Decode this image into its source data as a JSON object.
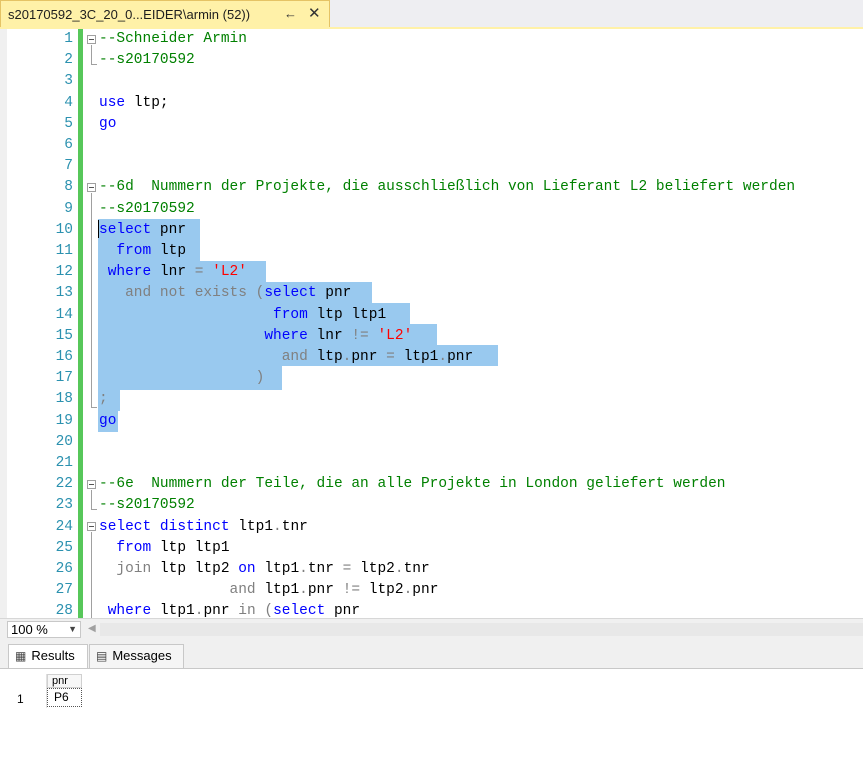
{
  "tab": {
    "title": "s20170592_3C_20_0...EIDER\\armin (52))",
    "pin_icon": "pin-icon",
    "close_icon": "close-icon"
  },
  "editor": {
    "lines": [
      {
        "n": "1",
        "segs": [
          {
            "t": "--Schneider Armin",
            "c": "cm"
          }
        ]
      },
      {
        "n": "2",
        "segs": [
          {
            "t": "--s20170592",
            "c": "cm"
          }
        ]
      },
      {
        "n": "3",
        "segs": []
      },
      {
        "n": "4",
        "segs": [
          {
            "t": "use",
            "c": "kw"
          },
          {
            "t": " ltp;",
            "c": ""
          }
        ]
      },
      {
        "n": "5",
        "segs": [
          {
            "t": "go",
            "c": "kw"
          }
        ]
      },
      {
        "n": "6",
        "segs": []
      },
      {
        "n": "7",
        "segs": []
      },
      {
        "n": "8",
        "segs": [
          {
            "t": "--6d  Nummern der Projekte, die ausschließlich von Lieferant L2 beliefert werden",
            "c": "cm"
          }
        ]
      },
      {
        "n": "9",
        "segs": [
          {
            "t": "--s20170592",
            "c": "cm"
          }
        ]
      },
      {
        "n": "10",
        "segs": [
          {
            "t": "select",
            "c": "kw"
          },
          {
            "t": " pnr",
            "c": ""
          }
        ]
      },
      {
        "n": "11",
        "segs": [
          {
            "t": "  ",
            "c": ""
          },
          {
            "t": "from",
            "c": "kw"
          },
          {
            "t": " ltp",
            "c": ""
          }
        ]
      },
      {
        "n": "12",
        "segs": [
          {
            "t": " ",
            "c": ""
          },
          {
            "t": "where",
            "c": "kw"
          },
          {
            "t": " lnr ",
            "c": ""
          },
          {
            "t": "=",
            "c": "gr"
          },
          {
            "t": " ",
            "c": ""
          },
          {
            "t": "'L2'",
            "c": "st"
          }
        ]
      },
      {
        "n": "13",
        "segs": [
          {
            "t": "   ",
            "c": ""
          },
          {
            "t": "and not exists (",
            "c": "gr"
          },
          {
            "t": "select",
            "c": "kw"
          },
          {
            "t": " pnr",
            "c": ""
          }
        ]
      },
      {
        "n": "14",
        "segs": [
          {
            "t": "                    ",
            "c": ""
          },
          {
            "t": "from",
            "c": "kw"
          },
          {
            "t": " ltp ltp1",
            "c": ""
          }
        ]
      },
      {
        "n": "15",
        "segs": [
          {
            "t": "                   ",
            "c": ""
          },
          {
            "t": "where",
            "c": "kw"
          },
          {
            "t": " lnr ",
            "c": ""
          },
          {
            "t": "!=",
            "c": "gr"
          },
          {
            "t": " ",
            "c": ""
          },
          {
            "t": "'L2'",
            "c": "st"
          }
        ]
      },
      {
        "n": "16",
        "segs": [
          {
            "t": "                     ",
            "c": ""
          },
          {
            "t": "and",
            "c": "gr"
          },
          {
            "t": " ltp",
            "c": ""
          },
          {
            "t": ".",
            "c": "gr"
          },
          {
            "t": "pnr ",
            "c": ""
          },
          {
            "t": "=",
            "c": "gr"
          },
          {
            "t": " ltp1",
            "c": ""
          },
          {
            "t": ".",
            "c": "gr"
          },
          {
            "t": "pnr",
            "c": ""
          }
        ]
      },
      {
        "n": "17",
        "segs": [
          {
            "t": "                  ",
            "c": ""
          },
          {
            "t": ")",
            "c": "gr"
          }
        ]
      },
      {
        "n": "18",
        "segs": [
          {
            "t": ";",
            "c": "gr"
          }
        ]
      },
      {
        "n": "19",
        "segs": [
          {
            "t": "go",
            "c": "kw"
          }
        ]
      },
      {
        "n": "20",
        "segs": []
      },
      {
        "n": "21",
        "segs": []
      },
      {
        "n": "22",
        "segs": [
          {
            "t": "--6e  Nummern der Teile, die an alle Projekte in London geliefert werden",
            "c": "cm"
          }
        ]
      },
      {
        "n": "23",
        "segs": [
          {
            "t": "--s20170592",
            "c": "cm"
          }
        ]
      },
      {
        "n": "24",
        "segs": [
          {
            "t": "select distinct",
            "c": "kw"
          },
          {
            "t": " ltp1",
            "c": ""
          },
          {
            "t": ".",
            "c": "gr"
          },
          {
            "t": "tnr",
            "c": ""
          }
        ]
      },
      {
        "n": "25",
        "segs": [
          {
            "t": "  ",
            "c": ""
          },
          {
            "t": "from",
            "c": "kw"
          },
          {
            "t": " ltp ltp1",
            "c": ""
          }
        ]
      },
      {
        "n": "26",
        "segs": [
          {
            "t": "  ",
            "c": ""
          },
          {
            "t": "join",
            "c": "gr"
          },
          {
            "t": " ltp ltp2 ",
            "c": ""
          },
          {
            "t": "on",
            "c": "kw"
          },
          {
            "t": " ltp1",
            "c": ""
          },
          {
            "t": ".",
            "c": "gr"
          },
          {
            "t": "tnr ",
            "c": ""
          },
          {
            "t": "=",
            "c": "gr"
          },
          {
            "t": " ltp2",
            "c": ""
          },
          {
            "t": ".",
            "c": "gr"
          },
          {
            "t": "tnr",
            "c": ""
          }
        ]
      },
      {
        "n": "27",
        "segs": [
          {
            "t": "               ",
            "c": ""
          },
          {
            "t": "and",
            "c": "gr"
          },
          {
            "t": " ltp1",
            "c": ""
          },
          {
            "t": ".",
            "c": "gr"
          },
          {
            "t": "pnr ",
            "c": ""
          },
          {
            "t": "!=",
            "c": "gr"
          },
          {
            "t": " ltp2",
            "c": ""
          },
          {
            "t": ".",
            "c": "gr"
          },
          {
            "t": "pnr",
            "c": ""
          }
        ]
      },
      {
        "n": "28",
        "segs": [
          {
            "t": " ",
            "c": ""
          },
          {
            "t": "where",
            "c": "kw"
          },
          {
            "t": " ltp1",
            "c": ""
          },
          {
            "t": ".",
            "c": "gr"
          },
          {
            "t": "pnr ",
            "c": ""
          },
          {
            "t": "in (",
            "c": "gr"
          },
          {
            "t": "select",
            "c": "kw"
          },
          {
            "t": " pnr",
            "c": ""
          }
        ]
      }
    ]
  },
  "zoom": {
    "value": "100 %"
  },
  "result_tabs": {
    "results_label": "Results",
    "messages_label": "Messages"
  },
  "results": {
    "columns": [
      "pnr"
    ],
    "rows": [
      {
        "num": "1",
        "cells": [
          "P6"
        ]
      }
    ]
  },
  "colors": {
    "keyword": "#0000ff",
    "comment": "#008000",
    "string": "#ff0000",
    "operator": "#808080",
    "selection": "#99c9ef",
    "line_numbers": "#2b91af",
    "tab": "#fff1a8"
  }
}
